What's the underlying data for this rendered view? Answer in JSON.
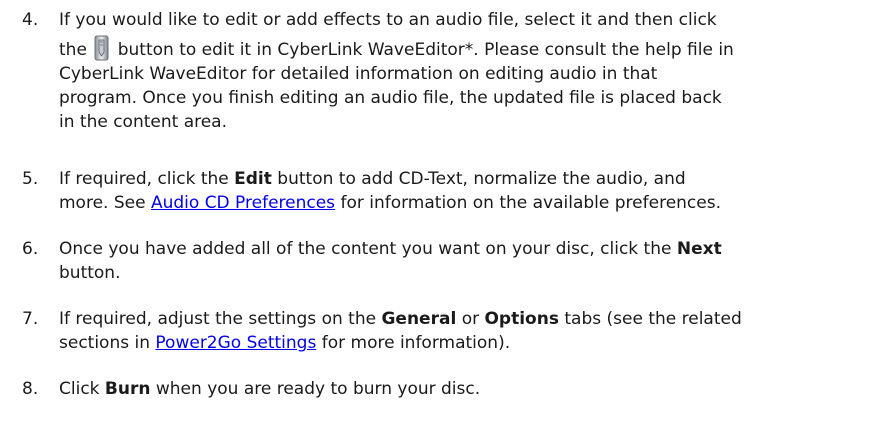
{
  "steps": [
    {
      "number": "4.",
      "line1": "If you would like to edit or add effects to an audio file, select it and then click",
      "line2_pre": "the",
      "line2_post": "button to edit it in CyberLink WaveEditor*. Please consult the help file in",
      "line3": "CyberLink WaveEditor for detailed information on editing audio in that",
      "line4": "program. Once you finish editing an audio file, the updated file is placed back",
      "line5": "in the content area.",
      "icon": "edit-pencil-icon"
    },
    {
      "number": "5.",
      "pre": "If required, click the",
      "bold": "Edit",
      "post": "button to add CD-Text, normalize the audio, and",
      "line2_pre": "more. See",
      "link": "Audio CD Preferences",
      "line2_post": "for information on the available preferences."
    },
    {
      "number": "6.",
      "pre": "Once you have added all of the content you want on your disc, click the",
      "bold": "Next",
      "line2": "button."
    },
    {
      "number": "7.",
      "pre": "If required, adjust the settings on the",
      "bold1": "General",
      "mid": "or",
      "bold2": "Options",
      "post": "tabs (see the related",
      "line2_pre": "sections in",
      "link": "Power2Go Settings",
      "line2_post": "for more information)."
    },
    {
      "number": "8.",
      "pre": "Click",
      "bold": "Burn",
      "post": "when you are ready to burn your disc."
    }
  ]
}
